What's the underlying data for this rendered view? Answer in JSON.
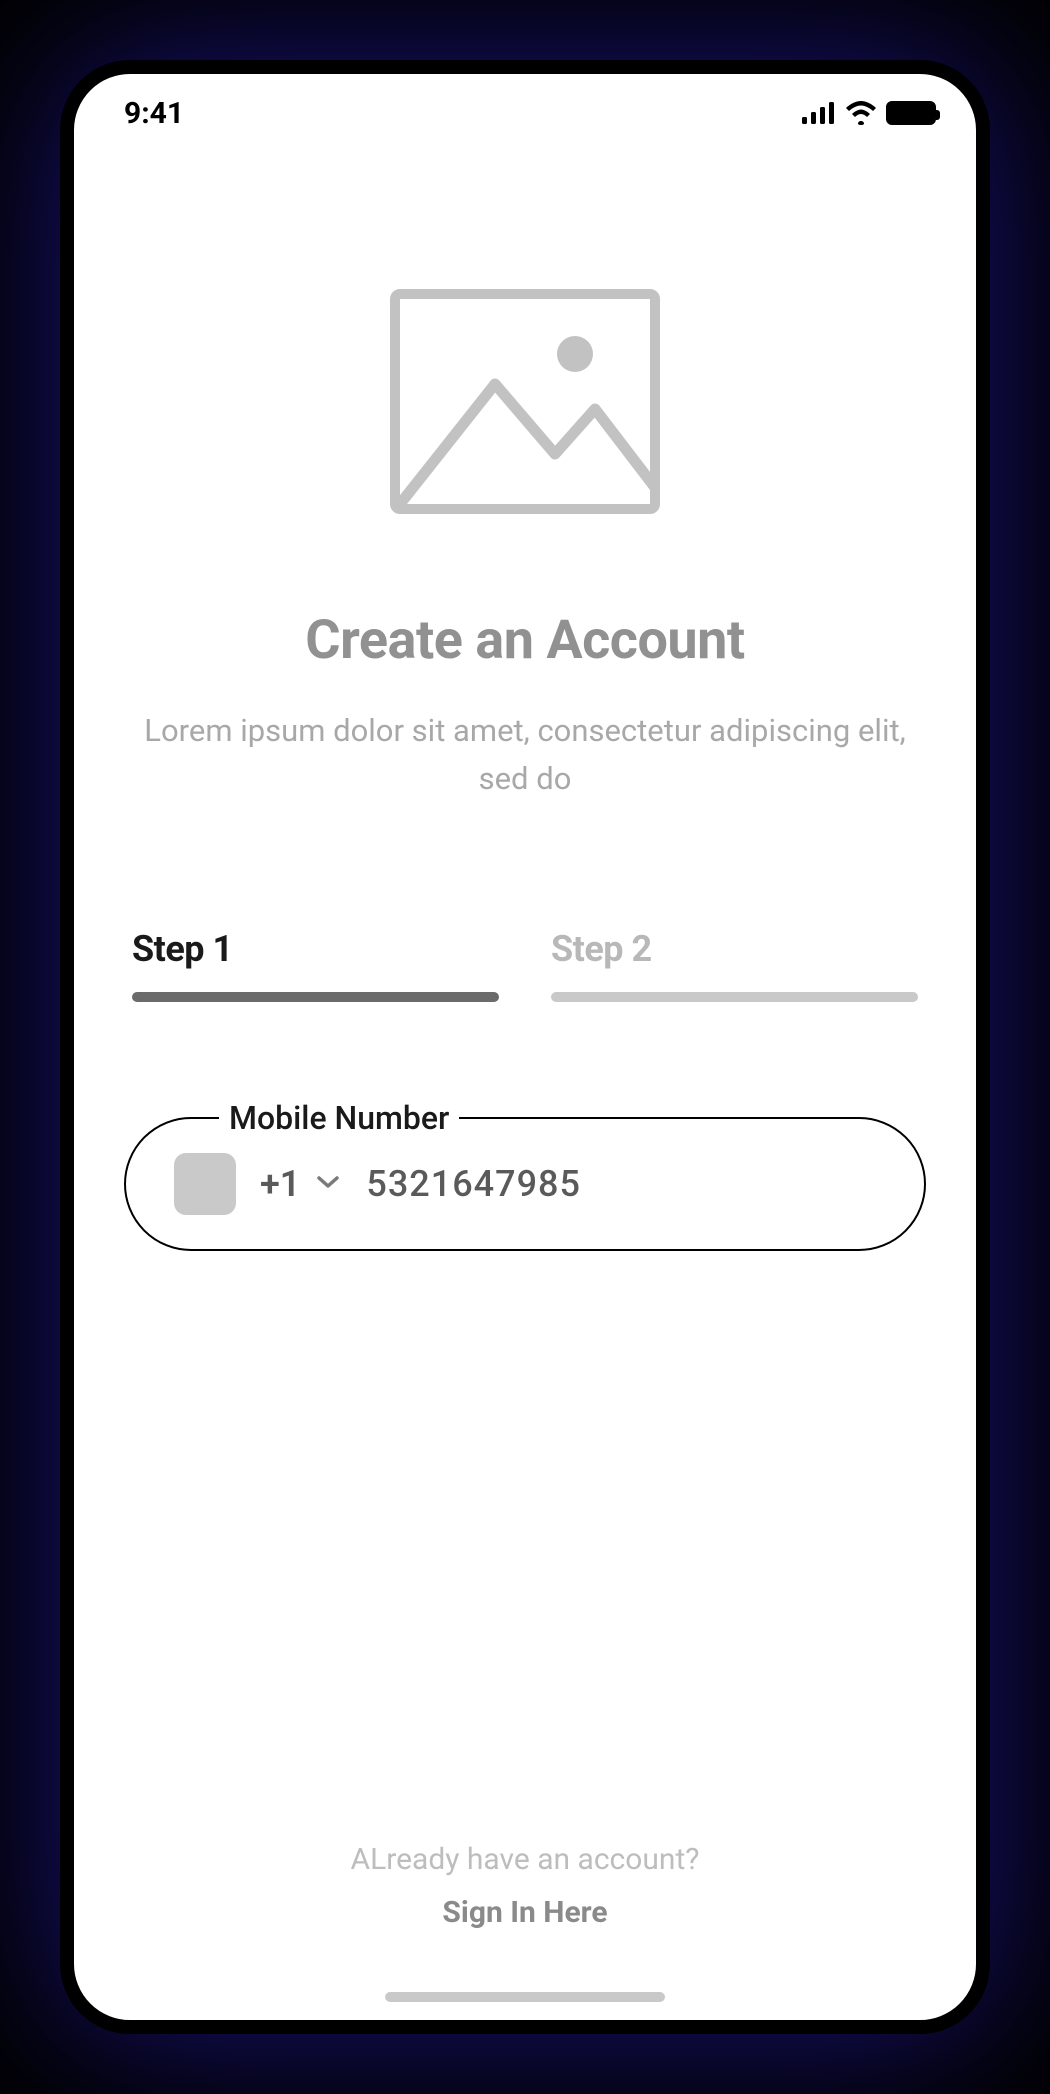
{
  "statusBar": {
    "time": "9:41"
  },
  "hero": {
    "title": "Create an Account",
    "subtitle": "Lorem ipsum dolor sit amet, consectetur adipiscing elit, sed do"
  },
  "steps": [
    {
      "label": "Step 1",
      "active": true
    },
    {
      "label": "Step 2",
      "active": false
    }
  ],
  "form": {
    "phone": {
      "label": "Mobile Number",
      "dialCode": "+1",
      "value": "5321647985"
    }
  },
  "footer": {
    "question": "ALready have an account?",
    "linkText": "Sign In Here"
  }
}
